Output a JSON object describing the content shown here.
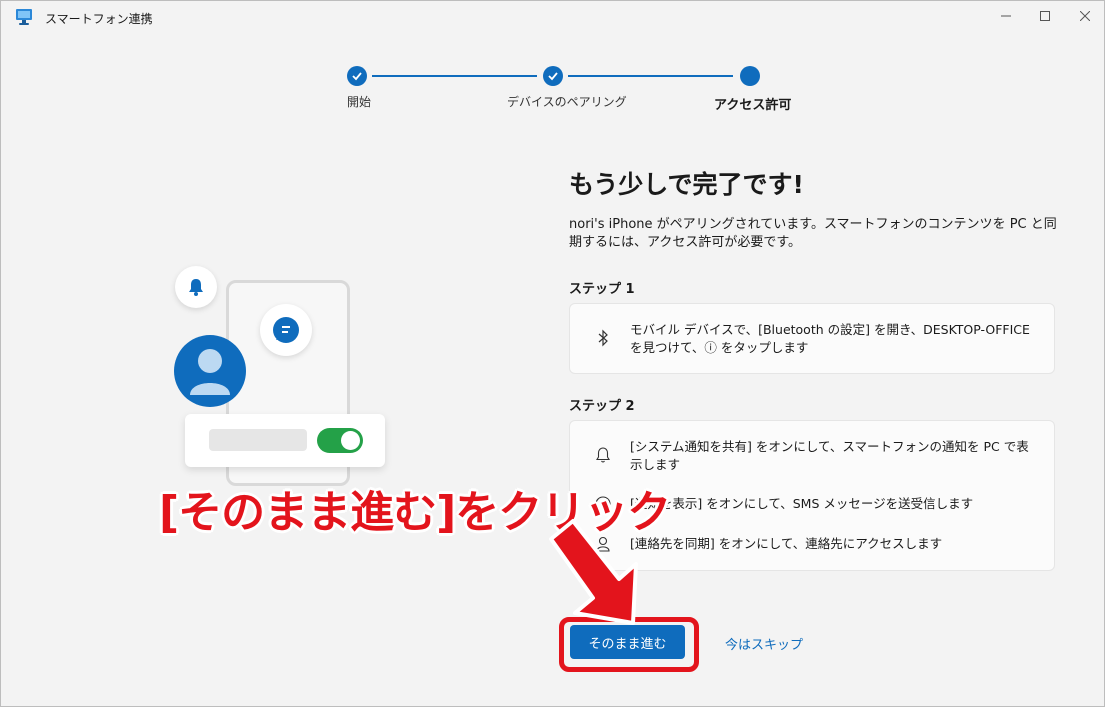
{
  "window": {
    "title": "スマートフォン連携",
    "controls": [
      "minimize-icon",
      "maximize-icon",
      "close-icon"
    ]
  },
  "stepper": {
    "steps": [
      {
        "label": "開始",
        "state": "done"
      },
      {
        "label": "デバイスのペアリング",
        "state": "done"
      },
      {
        "label": "アクセス許可",
        "state": "current"
      }
    ]
  },
  "main": {
    "heading": "もう少しで完了です!",
    "description": "nori's iPhone がペアリングされています。スマートフォンのコンテンツを PC と同期するには、アクセス許可が必要です。",
    "step1": {
      "title": "ステップ 1",
      "items": [
        {
          "icon": "bluetooth-icon",
          "text": "モバイル デバイスで、[Bluetooth の設定] を開き、DESKTOP-OFFICE を見つけて、ⓘ をタップします"
        }
      ]
    },
    "step2": {
      "title": "ステップ 2",
      "items": [
        {
          "icon": "bell-icon",
          "text": "[システム通知を共有] をオンにして、スマートフォンの通知を PC で表示します"
        },
        {
          "icon": "chat-icon",
          "text": "[通知を表示] をオンにして、SMS メッセージを送受信します"
        },
        {
          "icon": "person-icon",
          "text": "[連絡先を同期] をオンにして、連絡先にアクセスします"
        }
      ]
    }
  },
  "actions": {
    "primary_label": "そのまま進む",
    "skip_label": "今はスキップ"
  },
  "annotation": {
    "text": "[そのまま進む]をクリック",
    "color": "#e3141c"
  },
  "colors": {
    "accent": "#0f6cbd",
    "toggle_on": "#24a148",
    "background": "#f3f3f3"
  }
}
